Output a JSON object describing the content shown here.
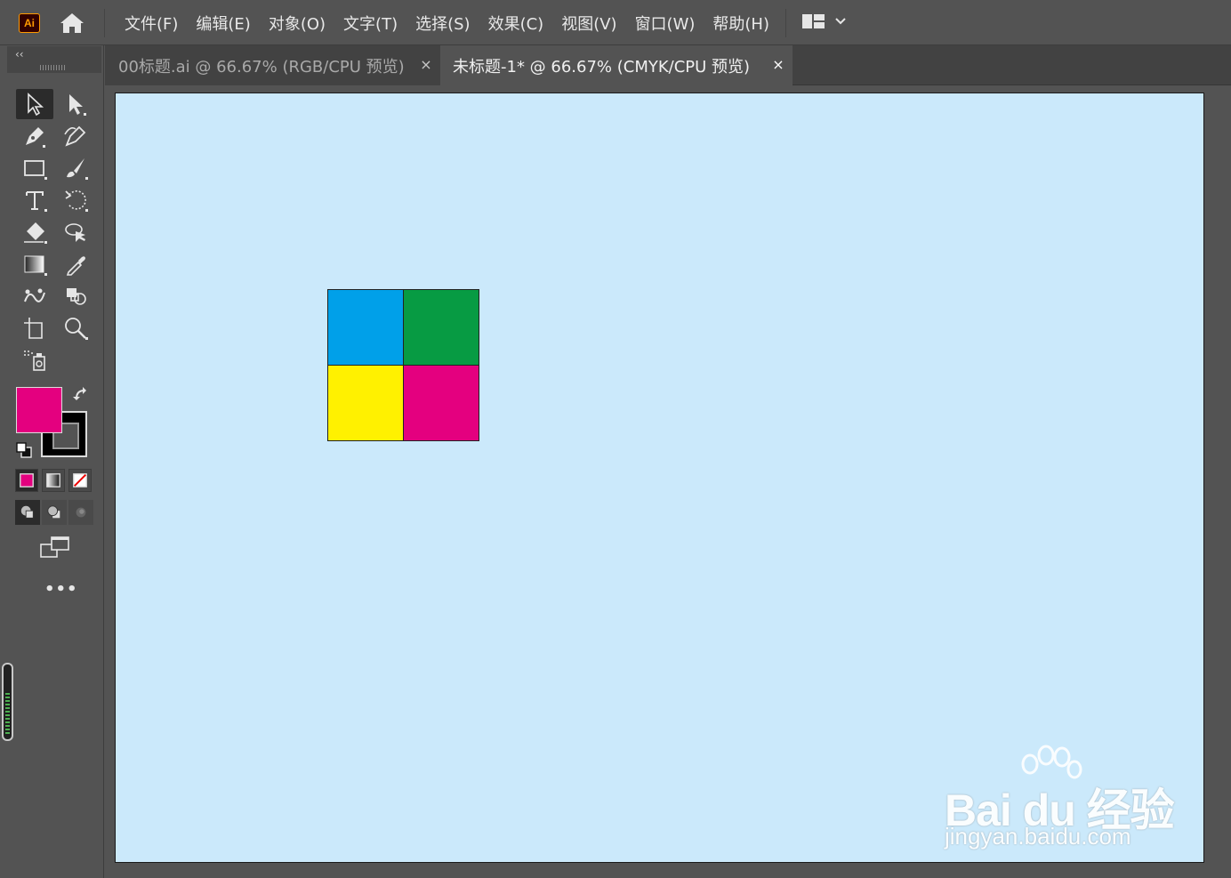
{
  "app": {
    "logo_text": "Ai"
  },
  "menu": {
    "items": [
      "文件(F)",
      "编辑(E)",
      "对象(O)",
      "文字(T)",
      "选择(S)",
      "效果(C)",
      "视图(V)",
      "窗口(W)",
      "帮助(H)"
    ]
  },
  "tabs": [
    {
      "label": "00标题.ai @ 66.67% (RGB/CPU 预览)",
      "close": "×",
      "active": false
    },
    {
      "label": "未标题-1* @ 66.67% (CMYK/CPU 预览)",
      "close": "×",
      "active": true
    }
  ],
  "toolbar": {
    "collapse": "‹‹",
    "more": "•••",
    "fill_color": "#e4007f",
    "stroke_color": "#000000",
    "tools": [
      "selection-tool",
      "direct-selection-tool",
      "pen-tool",
      "curvature-tool",
      "rectangle-tool",
      "paintbrush-tool",
      "type-tool",
      "rotate-tool",
      "eraser-tool",
      "lasso-tool",
      "gradient-tool",
      "eyedropper-tool",
      "puppet-warp-tool",
      "shape-builder-tool",
      "artboard-tool",
      "zoom-tool",
      "symbol-sprayer-tool"
    ]
  },
  "artboard": {
    "background": "#cbe9fb",
    "squares": [
      {
        "name": "cyan",
        "color": "#00a0e9"
      },
      {
        "name": "green",
        "color": "#079b43"
      },
      {
        "name": "yellow",
        "color": "#fff100"
      },
      {
        "name": "magenta",
        "color": "#e4007f"
      }
    ]
  },
  "watermark": {
    "logo_text": "Bai du 经验",
    "url": "jingyan.baidu.com"
  }
}
